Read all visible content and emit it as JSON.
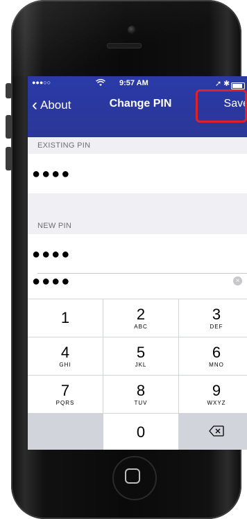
{
  "status_bar": {
    "signal": "●●●○○",
    "wifi": "wifi-icon",
    "time": "9:57 AM",
    "location": "➚",
    "bluetooth": "✱"
  },
  "nav": {
    "back_label": "About",
    "title": "Change PIN",
    "save_label": "Save"
  },
  "form": {
    "existing_label": "EXISTING PIN",
    "existing_value": "●●●●",
    "new_label": "NEW PIN",
    "new_value": "●●●●",
    "confirm_value": "●●●●"
  },
  "keypad": {
    "keys": [
      {
        "num": "1",
        "letters": ""
      },
      {
        "num": "2",
        "letters": "ABC"
      },
      {
        "num": "3",
        "letters": "DEF"
      },
      {
        "num": "4",
        "letters": "GHI"
      },
      {
        "num": "5",
        "letters": "JKL"
      },
      {
        "num": "6",
        "letters": "MNO"
      },
      {
        "num": "7",
        "letters": "PQRS"
      },
      {
        "num": "8",
        "letters": "TUV"
      },
      {
        "num": "9",
        "letters": "WXYZ"
      },
      {
        "num": "0",
        "letters": ""
      }
    ]
  },
  "colors": {
    "nav_bg": "#2b3797",
    "highlight_box": "#e0202a"
  }
}
